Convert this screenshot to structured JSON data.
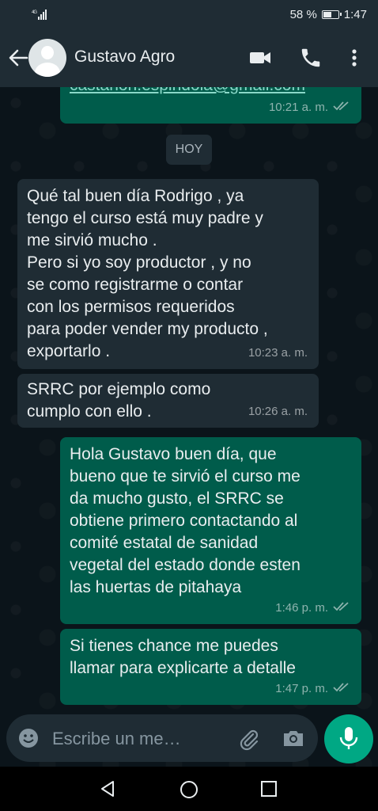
{
  "status": {
    "battery": "58 %",
    "battery_level": 0.58,
    "time": "1:47",
    "signal": "4G"
  },
  "header": {
    "contact_name": "Gustavo Agro"
  },
  "messages": {
    "m0": {
      "text": "castanon.espindola@gmail.com",
      "time": "10:21 a. m."
    },
    "day": "HOY",
    "m1": {
      "text": "Qué tal buen día Rodrigo , ya\ntengo el curso está muy padre y\nme sirvió mucho .\nPero si yo soy productor , y no\nse como registrarme o contar\ncon los permisos  requeridos\npara poder vender my producto ,\nexportarlo .",
      "time": "10:23 a. m."
    },
    "m2": {
      "text": "SRRC  por ejemplo como\ncumplo con ello .",
      "time": "10:26 a. m."
    },
    "m3": {
      "text": "Hola Gustavo buen día, que\nbueno que te sirvió el curso me\nda mucho gusto, el SRRC se\nobtiene primero contactando al\ncomité estatal de sanidad\nvegetal del estado donde esten\nlas huertas de pitahaya",
      "time": "1:46 p. m."
    },
    "m4": {
      "text": "Si tienes chance me puedes\nllamar para explicarte a detalle",
      "time": "1:47 p. m."
    }
  },
  "composer": {
    "placeholder": "Escribe un me…"
  }
}
